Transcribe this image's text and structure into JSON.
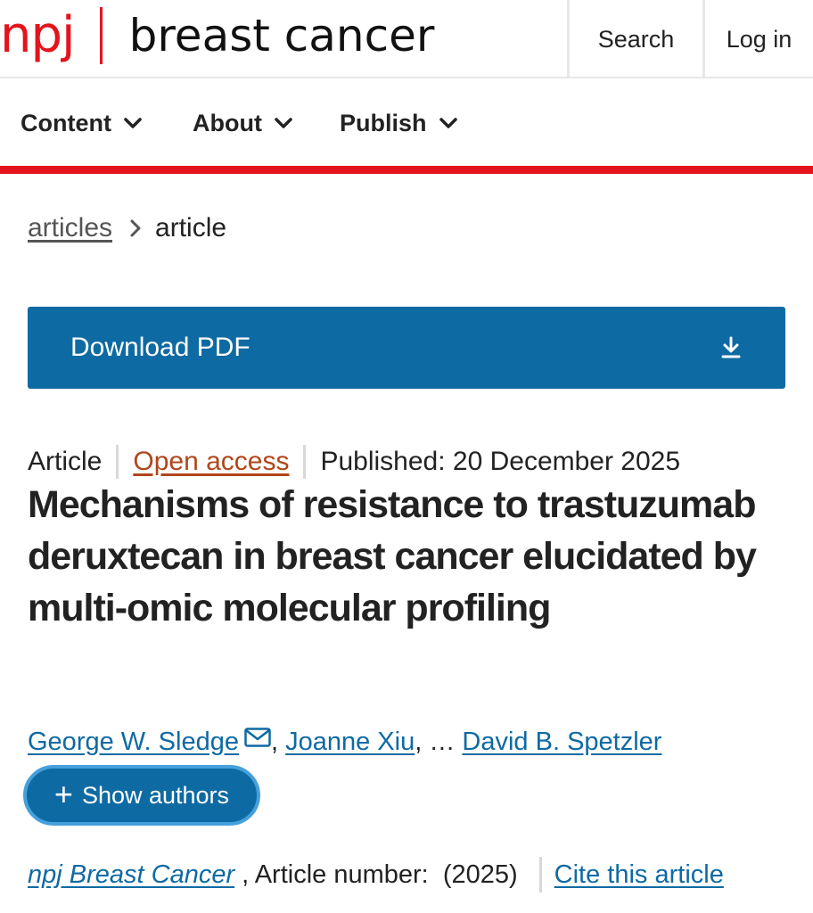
{
  "header": {
    "logo_brand": "npj",
    "logo_journal": "breast cancer",
    "search_label": "Search",
    "login_label": "Log in"
  },
  "nav": {
    "items": [
      {
        "label": "Content",
        "icon": "chevron-down-icon"
      },
      {
        "label": "About",
        "icon": "chevron-down-icon"
      },
      {
        "label": "Publish",
        "icon": "chevron-down-icon"
      }
    ]
  },
  "breadcrumb": {
    "items": [
      {
        "label": "articles"
      },
      {
        "label": "article"
      }
    ],
    "separator_icon": "chevron-right-icon"
  },
  "download": {
    "label": "Download PDF",
    "icon": "download-icon"
  },
  "article": {
    "type": "Article",
    "access": "Open access",
    "published": "Published: 20 December 2025",
    "title": "Mechanisms of resistance to trastuzumab deruxtecan in breast cancer elucidated by multi-omic molecular profiling"
  },
  "authors": {
    "first": "George W. Sledge",
    "second": "Joanne Xiu",
    "sep_comma": ",",
    "ellipsis": ", …",
    "last": "David B. Spetzler",
    "show_label": "Show authors",
    "mail_icon": "mail-icon"
  },
  "citation": {
    "journal": "npj Breast Cancer",
    "article_number": " , Article number:  (2025)",
    "cite_label": "Cite this article"
  },
  "colors": {
    "brand_red": "#e3141c",
    "link_blue": "#0e6aa3",
    "open_access_orange": "#b0461b"
  }
}
